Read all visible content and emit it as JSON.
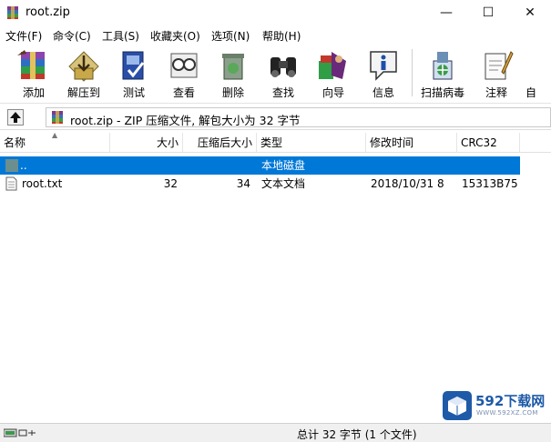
{
  "window": {
    "title": "root.zip",
    "controls": {
      "minimize": "—",
      "maximize": "☐",
      "close": "✕"
    }
  },
  "menu": [
    "文件(F)",
    "命令(C)",
    "工具(S)",
    "收藏夹(O)",
    "选项(N)",
    "帮助(H)"
  ],
  "toolbar": [
    {
      "label": "添加",
      "icon": "add-icon"
    },
    {
      "label": "解压到",
      "icon": "extract-icon"
    },
    {
      "label": "测试",
      "icon": "test-icon"
    },
    {
      "label": "查看",
      "icon": "view-icon"
    },
    {
      "label": "删除",
      "icon": "delete-icon"
    },
    {
      "label": "查找",
      "icon": "find-icon"
    },
    {
      "label": "向导",
      "icon": "wizard-icon"
    },
    {
      "label": "信息",
      "icon": "info-icon"
    },
    {
      "label": "扫描病毒",
      "icon": "virus-scan-icon"
    },
    {
      "label": "注释",
      "icon": "comment-icon"
    },
    {
      "label": "自",
      "icon": "sfx-icon"
    }
  ],
  "address": {
    "text": "root.zip - ZIP 压缩文件, 解包大小为 32 字节"
  },
  "columns": {
    "name": "名称",
    "size": "大小",
    "packed": "压缩后大小",
    "type": "类型",
    "modified": "修改时间",
    "crc": "CRC32"
  },
  "rows": [
    {
      "name": "..",
      "size": "",
      "packed": "",
      "type": "本地磁盘",
      "modified": "",
      "crc": "",
      "selected": true
    },
    {
      "name": "root.txt",
      "size": "32",
      "packed": "34",
      "type": "文本文档",
      "modified": "2018/10/31 8",
      "crc": "15313B75",
      "selected": false
    }
  ],
  "status": {
    "text": "总计 32 字节 (1 个文件)"
  },
  "watermark": {
    "brand": "592下载网",
    "url": "WWW.592XZ.COM"
  },
  "colors": {
    "selection": "#0078d7",
    "watermark": "#1e5aa8"
  }
}
